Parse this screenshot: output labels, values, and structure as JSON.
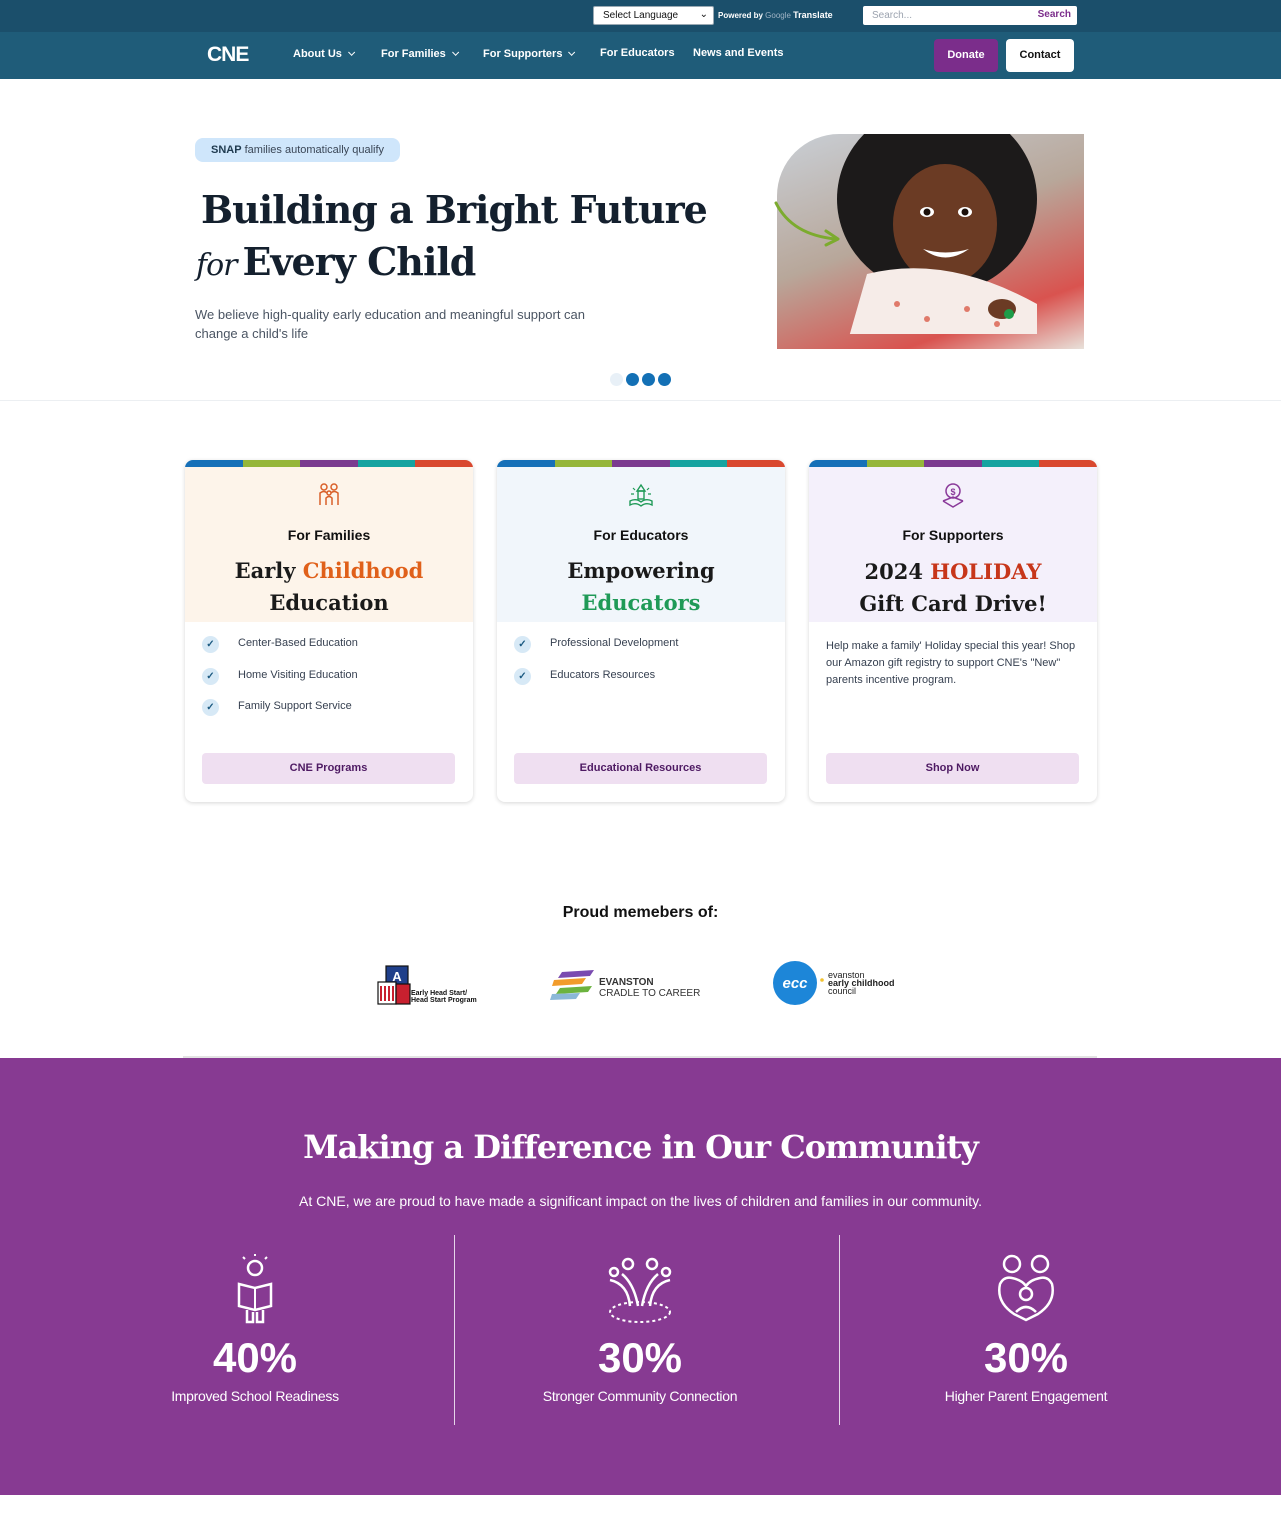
{
  "topbar": {
    "language_select": "Select Language",
    "powered_by": "Powered by",
    "google_label": "Google",
    "translate_label": "Translate",
    "search_placeholder": "Search...",
    "search_button": "Search"
  },
  "nav": {
    "logo_text": "CNE",
    "items": [
      {
        "label": "About Us",
        "dropdown": true
      },
      {
        "label": "For Families",
        "dropdown": true
      },
      {
        "label": "For Supporters",
        "dropdown": true
      },
      {
        "label": "For Educators",
        "dropdown": false
      },
      {
        "label": "News and Events",
        "dropdown": false
      }
    ],
    "donate_label": "Donate",
    "contact_label": "Contact"
  },
  "hero": {
    "badge_bold": "SNAP",
    "badge_text": "families automatically qualify",
    "title_line1": "Building a Bright Future",
    "title_for": "for",
    "title_line2": "Every Child",
    "subtitle": "We believe high-quality early education and meaningful support can change a child's life",
    "slide_count": 4,
    "active_slide": 1
  },
  "colors": {
    "stripe": [
      "#1670b8",
      "#95b63a",
      "#7b3a8f",
      "#16a3a0",
      "#d9482f"
    ],
    "primary_purple": "#7b2d8b",
    "nav_blue": "#1f5c79"
  },
  "cards": [
    {
      "icon": "family-icon",
      "kicker": "For Families",
      "head_a": "Early ",
      "head_b": "Childhood",
      "head_c": "Education",
      "bullets": [
        "Center-Based Education",
        "Home Visiting Education",
        "Family Support Service"
      ],
      "button": "CNE Programs"
    },
    {
      "icon": "school-book-icon",
      "kicker": "For Educators",
      "head_a": "Empowering",
      "head_b": "Educators",
      "bullets": [
        "Professional Development",
        "Educators Resources"
      ],
      "button": "Educational Resources"
    },
    {
      "icon": "donation-icon",
      "kicker": "For Supporters",
      "head_a": "2024 ",
      "head_b": "HOLIDAY",
      "head_c": "Gift Card Drive!",
      "body": "Help make a family' Holiday special this year! Shop our Amazon gift registry to support CNE's \"New\" parents incentive program.",
      "button": "Shop Now"
    }
  ],
  "members": {
    "title": "Proud memebers of:",
    "logos": [
      {
        "line1": "Early Head Start/",
        "line2": "Head Start Program"
      },
      {
        "line1": "EVANSTON",
        "line2": "CRADLE TO CAREER"
      },
      {
        "line1": "evanston",
        "line2": "early childhood",
        "line3": "council",
        "mark": "ecc"
      }
    ]
  },
  "impact": {
    "title": "Making a Difference in Our Community",
    "subtitle": "At CNE, we are proud to have made a significant impact on the lives of children and families in our community.",
    "stats": [
      {
        "value": "40%",
        "label": "Improved School Readiness",
        "icon": "child-reading-icon"
      },
      {
        "value": "30%",
        "label": "Stronger Community Connection",
        "icon": "community-hands-icon"
      },
      {
        "value": "30%",
        "label": "Higher Parent Engagement",
        "icon": "parent-child-heart-icon"
      }
    ]
  }
}
